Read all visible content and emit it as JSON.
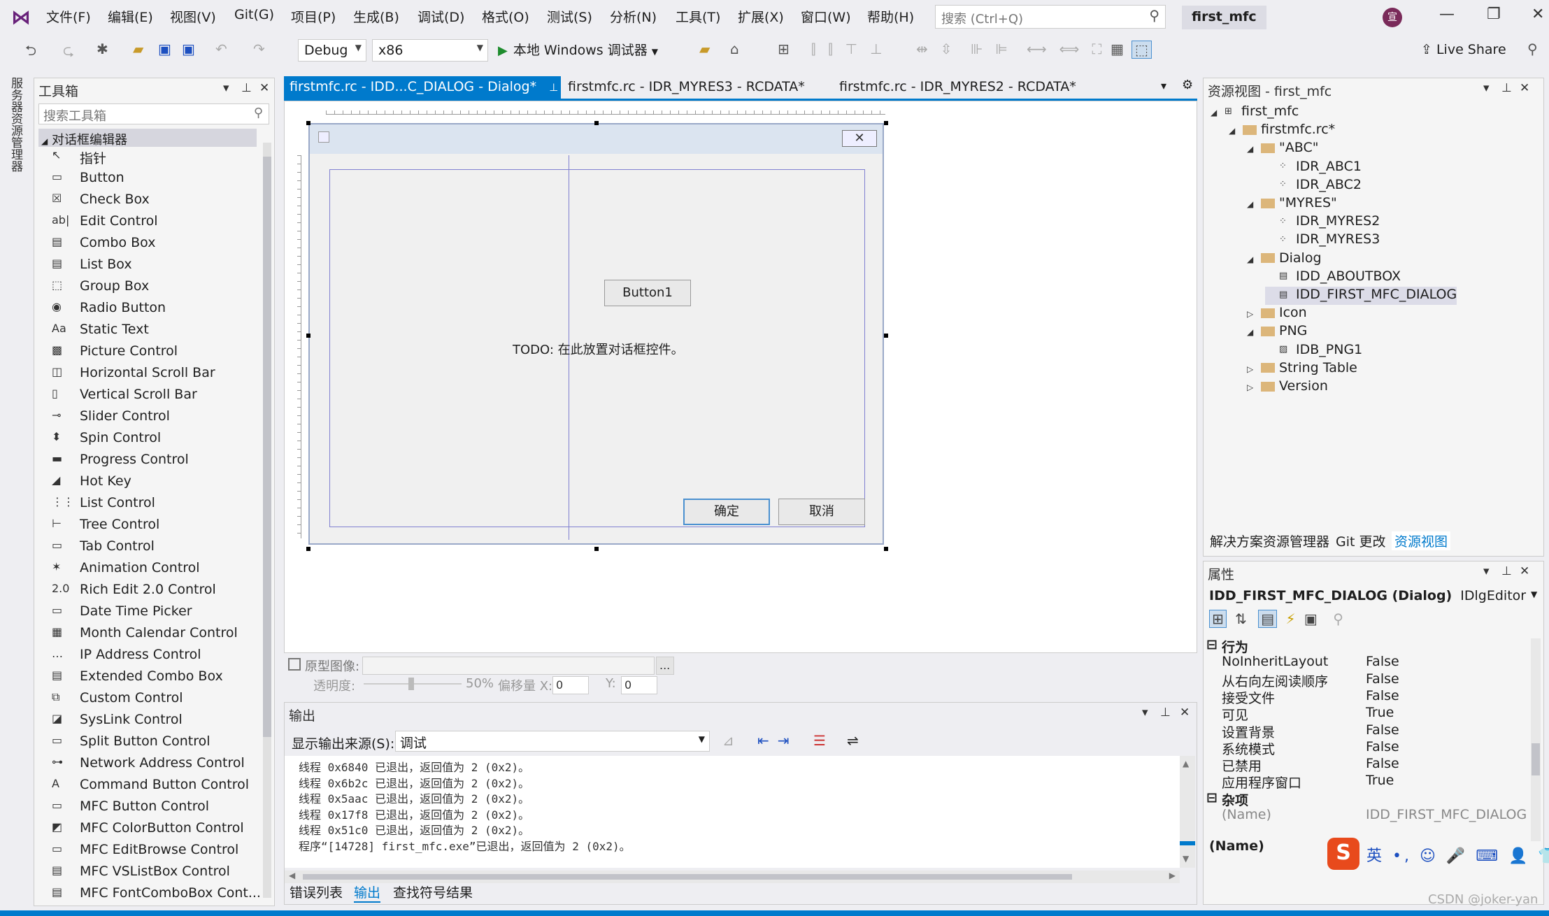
{
  "menubar": {
    "items": [
      "文件(F)",
      "编辑(E)",
      "视图(V)",
      "Git(G)",
      "项目(P)",
      "生成(B)",
      "调试(D)",
      "格式(O)",
      "测试(S)",
      "分析(N)",
      "工具(T)",
      "扩展(X)",
      "窗口(W)",
      "帮助(H)"
    ],
    "search_placeholder": "搜索 (Ctrl+Q)",
    "solution_name": "first_mfc",
    "avatar_text": "宣",
    "window_min": "—",
    "window_restore": "❐",
    "window_close": "✕"
  },
  "toolbar": {
    "config": "Debug",
    "platform": "x86",
    "run_label": "本地 Windows 调试器",
    "live_share": "Live Share"
  },
  "left_strip": {
    "server_explorer": "服务器资源管理器"
  },
  "toolbox": {
    "title": "工具箱",
    "search_placeholder": "搜索工具箱",
    "section": "对话框编辑器",
    "items": [
      {
        "icon": "↖",
        "label": "指针"
      },
      {
        "icon": "▭",
        "label": "Button"
      },
      {
        "icon": "☒",
        "label": "Check Box"
      },
      {
        "icon": "ab|",
        "label": "Edit Control"
      },
      {
        "icon": "▤",
        "label": "Combo Box"
      },
      {
        "icon": "▤",
        "label": "List Box"
      },
      {
        "icon": "⬚",
        "label": "Group Box"
      },
      {
        "icon": "◉",
        "label": "Radio Button"
      },
      {
        "icon": "Aa",
        "label": "Static Text"
      },
      {
        "icon": "▩",
        "label": "Picture Control"
      },
      {
        "icon": "◫",
        "label": "Horizontal Scroll Bar"
      },
      {
        "icon": "▯",
        "label": "Vertical Scroll Bar"
      },
      {
        "icon": "⊸",
        "label": "Slider Control"
      },
      {
        "icon": "⬍",
        "label": "Spin Control"
      },
      {
        "icon": "▬",
        "label": "Progress Control"
      },
      {
        "icon": "◢",
        "label": "Hot Key"
      },
      {
        "icon": "⋮⋮",
        "label": "List Control"
      },
      {
        "icon": "⊢",
        "label": "Tree Control"
      },
      {
        "icon": "▭",
        "label": "Tab Control"
      },
      {
        "icon": "✶",
        "label": "Animation Control"
      },
      {
        "icon": "2.0",
        "label": "Rich Edit 2.0 Control"
      },
      {
        "icon": "▭",
        "label": "Date Time Picker"
      },
      {
        "icon": "▦",
        "label": "Month Calendar Control"
      },
      {
        "icon": "…",
        "label": "IP Address Control"
      },
      {
        "icon": "▤",
        "label": "Extended Combo Box"
      },
      {
        "icon": "⧉",
        "label": "Custom Control"
      },
      {
        "icon": "◪",
        "label": "SysLink Control"
      },
      {
        "icon": "▭",
        "label": "Split Button Control"
      },
      {
        "icon": "⊶",
        "label": "Network Address Control"
      },
      {
        "icon": "A",
        "label": "Command Button Control"
      },
      {
        "icon": "▭",
        "label": "MFC Button Control"
      },
      {
        "icon": "◩",
        "label": "MFC ColorButton Control"
      },
      {
        "icon": "▭",
        "label": "MFC EditBrowse Control"
      },
      {
        "icon": "▤",
        "label": "MFC VSListBox Control"
      },
      {
        "icon": "▤",
        "label": "MFC FontComboBox Cont..."
      }
    ]
  },
  "doc_tabs": [
    {
      "label": "firstmfc.rc - IDD...C_DIALOG - Dialog*",
      "active": true
    },
    {
      "label": "firstmfc.rc - IDR_MYRES3 - RCDATA*",
      "active": false
    },
    {
      "label": "firstmfc.rc - IDR_MYRES2 - RCDATA*",
      "active": false
    }
  ],
  "dialog": {
    "button1": "Button1",
    "todo": "TODO: 在此放置对话框控件。",
    "ok": "确定",
    "cancel": "取消"
  },
  "prototype": {
    "label": "原型图像:",
    "opacity_label": "透明度:",
    "opacity_value": "50%",
    "offset_label": "偏移量 X:",
    "offset_x": "0",
    "y_label": "Y:",
    "offset_y": "0",
    "browse": "..."
  },
  "output": {
    "title": "输出",
    "source_label": "显示输出来源(S):",
    "source_value": "调试",
    "lines": [
      "线程 0x6840 已退出，返回值为 2 (0x2)。",
      "线程 0x6b2c 已退出，返回值为 2 (0x2)。",
      "线程 0x5aac 已退出，返回值为 2 (0x2)。",
      "线程 0x17f8 已退出，返回值为 2 (0x2)。",
      "线程 0x51c0 已退出，返回值为 2 (0x2)。",
      "程序“[14728] first_mfc.exe”已退出，返回值为 2 (0x2)。"
    ]
  },
  "bottom_tabs": [
    "错误列表",
    "输出",
    "查找符号结果"
  ],
  "resource_view": {
    "title": "资源视图 - first_mfc",
    "tree": [
      {
        "level": 0,
        "exp": "◢",
        "kind": "proj",
        "label": "first_mfc"
      },
      {
        "level": 1,
        "exp": "◢",
        "kind": "folder",
        "label": "firstmfc.rc*"
      },
      {
        "level": 2,
        "exp": "◢",
        "kind": "folder",
        "label": "\"ABC\""
      },
      {
        "level": 3,
        "exp": "",
        "kind": "res",
        "label": "IDR_ABC1"
      },
      {
        "level": 3,
        "exp": "",
        "kind": "res",
        "label": "IDR_ABC2"
      },
      {
        "level": 2,
        "exp": "◢",
        "kind": "folder",
        "label": "\"MYRES\""
      },
      {
        "level": 3,
        "exp": "",
        "kind": "res",
        "label": "IDR_MYRES2"
      },
      {
        "level": 3,
        "exp": "",
        "kind": "res",
        "label": "IDR_MYRES3"
      },
      {
        "level": 2,
        "exp": "◢",
        "kind": "folder",
        "label": "Dialog"
      },
      {
        "level": 3,
        "exp": "",
        "kind": "dlg",
        "label": "IDD_ABOUTBOX"
      },
      {
        "level": 3,
        "exp": "",
        "kind": "dlg",
        "label": "IDD_FIRST_MFC_DIALOG",
        "selected": true
      },
      {
        "level": 2,
        "exp": "▷",
        "kind": "folder",
        "label": "Icon"
      },
      {
        "level": 2,
        "exp": "◢",
        "kind": "folder",
        "label": "PNG"
      },
      {
        "level": 3,
        "exp": "",
        "kind": "img",
        "label": "IDB_PNG1"
      },
      {
        "level": 2,
        "exp": "▷",
        "kind": "folder",
        "label": "String Table"
      },
      {
        "level": 2,
        "exp": "▷",
        "kind": "folder",
        "label": "Version"
      }
    ],
    "tabs": [
      "解决方案资源管理器",
      "Git 更改",
      "资源视图"
    ]
  },
  "properties": {
    "title": "属性",
    "object_bold": "IDD_FIRST_MFC_DIALOG (Dialog)",
    "object_type": "IDlgEditor",
    "rows": [
      {
        "cat": true,
        "name": "行为",
        "value": ""
      },
      {
        "name": "NoInheritLayout",
        "value": "False"
      },
      {
        "name": "从右向左阅读顺序",
        "value": "False"
      },
      {
        "name": "接受文件",
        "value": "False"
      },
      {
        "name": "可见",
        "value": "True"
      },
      {
        "name": "设置背景",
        "value": "False"
      },
      {
        "name": "系统模式",
        "value": "False"
      },
      {
        "name": "已禁用",
        "value": "False"
      },
      {
        "name": "应用程序窗口",
        "value": "True"
      },
      {
        "cat": true,
        "name": "杂项",
        "value": ""
      },
      {
        "name": "(Name)",
        "value": "IDD_FIRST_MFC_DIALOG",
        "muted": true
      }
    ],
    "description_title": "(Name)"
  },
  "ime": {
    "s": "S",
    "rest": "英 •, ☺ 🎤 ⌨ 👤 👕 ⠿"
  },
  "watermark": "CSDN @joker-yan",
  "colors": {
    "accent": "#007acc",
    "selected_tab": "#007acc"
  }
}
